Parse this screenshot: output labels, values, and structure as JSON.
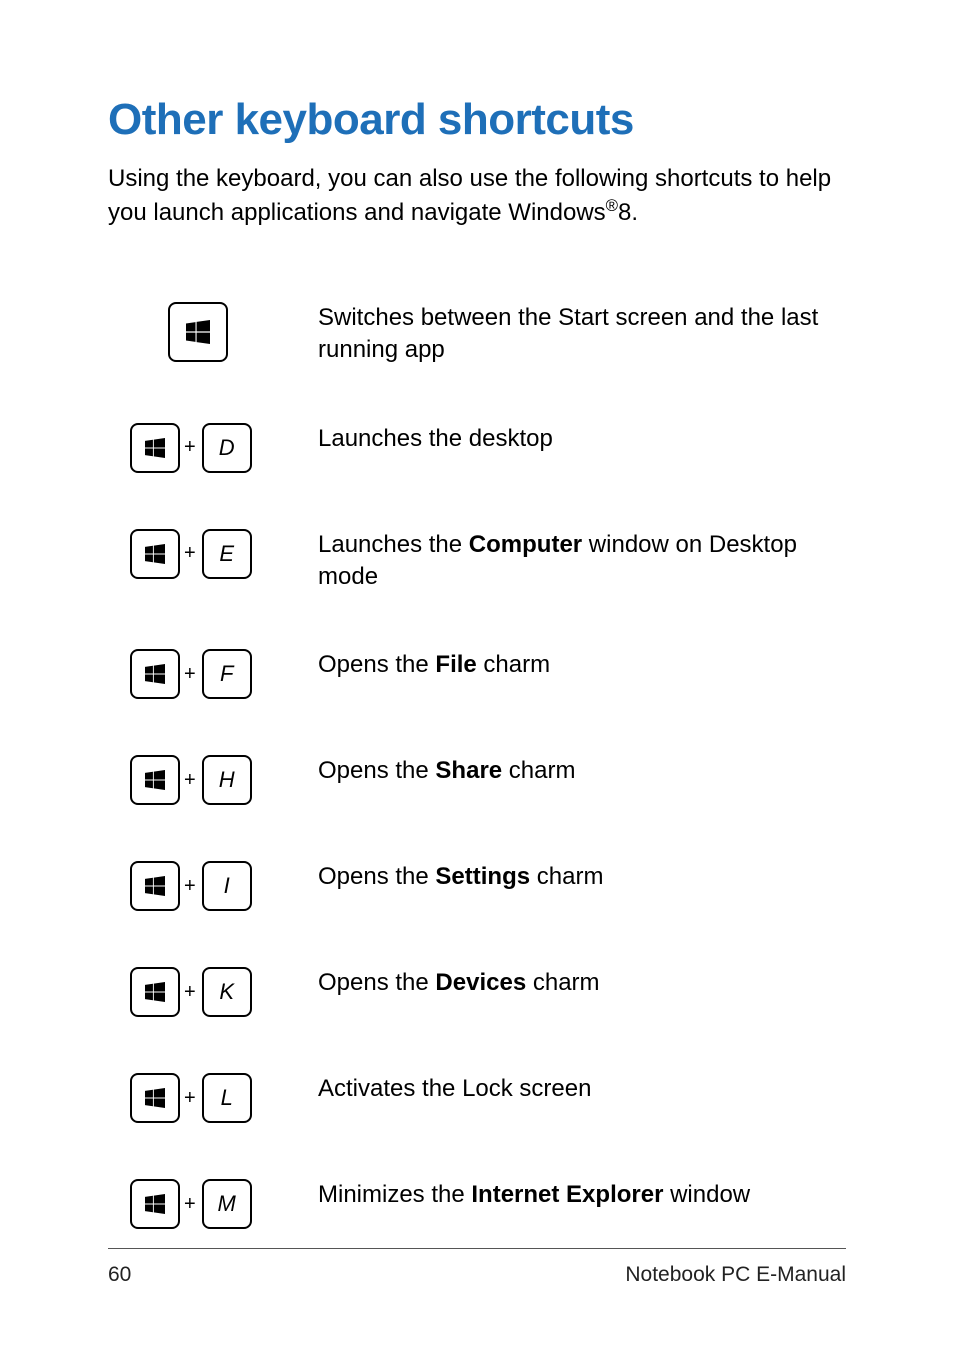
{
  "title": "Other keyboard shortcuts",
  "intro_before": "Using the keyboard, you can also use the following shortcuts to help you launch applications and navigate Windows",
  "intro_sup": "®",
  "intro_after": "8.",
  "plus": "+",
  "shortcuts": [
    {
      "key": "",
      "desc_before": "Switches between the Start screen and the last running app",
      "bold": "",
      "desc_after": ""
    },
    {
      "key": "D",
      "desc_before": "Launches the desktop",
      "bold": "",
      "desc_after": ""
    },
    {
      "key": "E",
      "desc_before": "Launches the ",
      "bold": "Computer",
      "desc_after": " window on Desktop mode"
    },
    {
      "key": "F",
      "desc_before": "Opens the ",
      "bold": "File",
      "desc_after": " charm"
    },
    {
      "key": "H",
      "desc_before": "Opens the ",
      "bold": "Share",
      "desc_after": " charm"
    },
    {
      "key": "I",
      "desc_before": "Opens the ",
      "bold": "Settings",
      "desc_after": " charm"
    },
    {
      "key": "K",
      "desc_before": "Opens the ",
      "bold": "Devices",
      "desc_after": " charm"
    },
    {
      "key": "L",
      "desc_before": "Activates the Lock screen",
      "bold": "",
      "desc_after": ""
    },
    {
      "key": "M",
      "desc_before": "Minimizes the ",
      "bold": "Internet Explorer",
      "desc_after": " window"
    }
  ],
  "footer": {
    "page": "60",
    "label": "Notebook PC E-Manual"
  }
}
